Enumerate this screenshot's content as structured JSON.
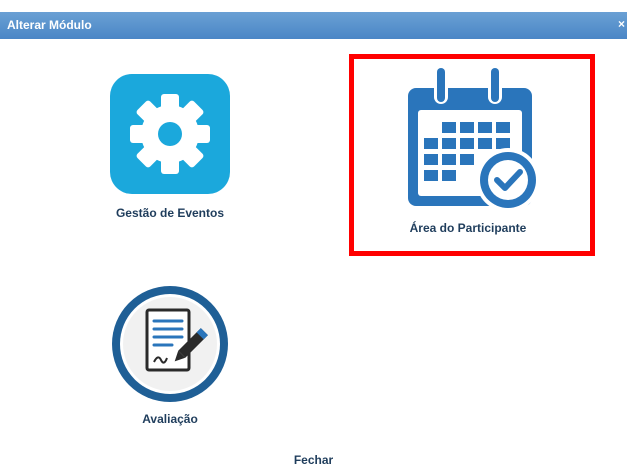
{
  "dialog": {
    "title": "Alterar Módulo",
    "close_glyph": "×"
  },
  "modules": [
    {
      "label": "Gestão de Eventos",
      "icon": "gear-icon"
    },
    {
      "label": "Área do Participante",
      "icon": "calendar-check-icon"
    },
    {
      "label": "Avaliação",
      "icon": "document-signature-icon"
    }
  ],
  "footer": {
    "close_label": "Fechar"
  },
  "colors": {
    "titlebar": "#4a86c6",
    "gear_tile": "#1ba8dc",
    "calendar": "#2a75bb",
    "highlight": "#ff0000",
    "label_text": "#1f3d5c"
  }
}
